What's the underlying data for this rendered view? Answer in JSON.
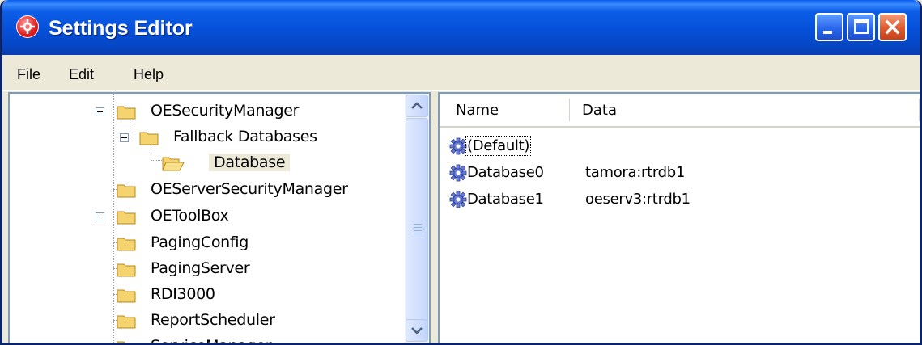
{
  "window": {
    "title": "Settings Editor"
  },
  "menu": {
    "file": "File",
    "edit": "Edit",
    "help": "Help"
  },
  "tree": {
    "nodes": [
      {
        "label": "OESecurityManager",
        "expanded": true
      },
      {
        "label": "Fallback Databases",
        "expanded": true
      },
      {
        "label": "Database",
        "selected": true,
        "open_folder": true
      },
      {
        "label": "OEServerSecurityManager"
      },
      {
        "label": "OEToolBox",
        "expandable": true
      },
      {
        "label": "PagingConfig"
      },
      {
        "label": "PagingServer"
      },
      {
        "label": "RDI3000"
      },
      {
        "label": "ReportScheduler"
      },
      {
        "label": "ServiceManager",
        "partially_visible": true
      }
    ]
  },
  "list": {
    "columns": {
      "name": "Name",
      "data": "Data"
    },
    "rows": [
      {
        "name": "(Default)",
        "data": ""
      },
      {
        "name": "Database0",
        "data": "tamora:rtrdb1"
      },
      {
        "name": "Database1",
        "data": "oeserv3:rtrdb1"
      }
    ]
  },
  "colors": {
    "titlebar": "#0a5cf0",
    "selection": "#ece9d8",
    "folder": "#f5d36e"
  }
}
